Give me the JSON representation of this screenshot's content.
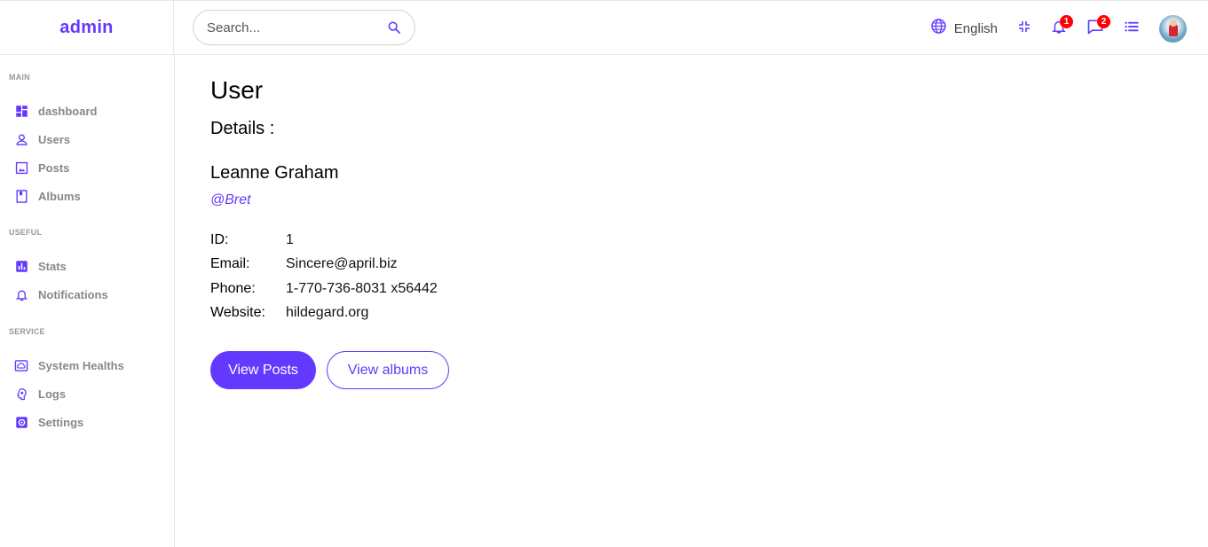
{
  "app": {
    "logo": "admin"
  },
  "search": {
    "placeholder": "Search..."
  },
  "topbar": {
    "language": "English",
    "notifications_count": "1",
    "messages_count": "2"
  },
  "colors": {
    "accent": "#6439ff",
    "badge": "#ff0000",
    "muted": "#888888"
  },
  "sidebar": {
    "sections": [
      {
        "title": "MAIN"
      },
      {
        "title": "USEFUL"
      },
      {
        "title": "SERVICE"
      }
    ],
    "items": [
      {
        "label": "dashboard",
        "icon": "dashboard-icon"
      },
      {
        "label": "Users",
        "icon": "person-icon"
      },
      {
        "label": "Posts",
        "icon": "image-icon"
      },
      {
        "label": "Albums",
        "icon": "album-icon"
      },
      {
        "label": "Stats",
        "icon": "bar-chart-icon"
      },
      {
        "label": "Notifications",
        "icon": "bell-icon"
      },
      {
        "label": "System Healths",
        "icon": "cloud-monitor-icon"
      },
      {
        "label": "Logs",
        "icon": "brain-icon"
      },
      {
        "label": "Settings",
        "icon": "settings-icon"
      }
    ]
  },
  "main": {
    "title": "User",
    "subtitle": "Details :",
    "name": "Leanne Graham",
    "handle": "@Bret",
    "fields": [
      {
        "key": "ID:",
        "value": "1"
      },
      {
        "key": "Email:",
        "value": "Sincere@april.biz"
      },
      {
        "key": "Phone:",
        "value": "1-770-736-8031 x56442"
      },
      {
        "key": "Website:",
        "value": "hildegard.org"
      }
    ],
    "buttons": {
      "primary": "View Posts",
      "secondary": "View albums"
    }
  }
}
